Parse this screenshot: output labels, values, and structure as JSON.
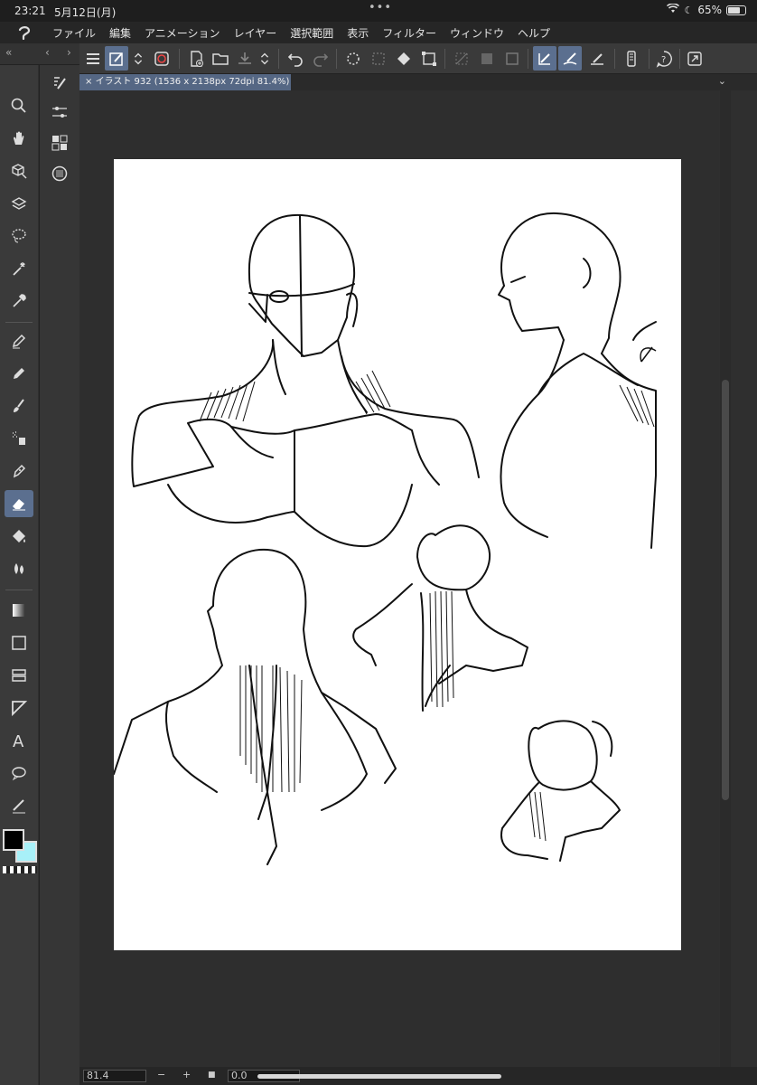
{
  "status": {
    "time": "23:21",
    "date": "5月12日(月)",
    "battery": "65%"
  },
  "menu": [
    "ファイル",
    "編集",
    "アニメーション",
    "レイヤー",
    "選択範囲",
    "表示",
    "フィルター",
    "ウィンドウ",
    "ヘルプ"
  ],
  "tab": {
    "label": "イラスト 932 (1536 x 2138px 72dpi 81.4%)"
  },
  "bottom": {
    "zoom": "81.4",
    "minus": "−",
    "plus": "+",
    "rotation": "0.0"
  },
  "colors": {
    "foreground": "#000000",
    "background": "#a8f0f8",
    "accent": "#5b6f8f"
  },
  "icons": {
    "left_tools": [
      "search-icon",
      "hand-icon",
      "move-3d-icon",
      "layer-move-icon",
      "lasso-icon",
      "magic-wand-icon",
      "eyedropper-icon",
      "pen-icon",
      "pencil-icon",
      "brush-icon",
      "airbrush-icon",
      "ink-pen-icon",
      "eraser-icon",
      "fill-icon",
      "blend-icon",
      "gradient-icon",
      "rectangle-icon",
      "ruler-icon",
      "frame-icon",
      "text-icon",
      "balloon-icon",
      "line-correct-icon"
    ],
    "sub_tools": [
      "subtool-brush-icon",
      "settings-sliders-icon",
      "navigator-icon",
      "material-icon"
    ]
  }
}
